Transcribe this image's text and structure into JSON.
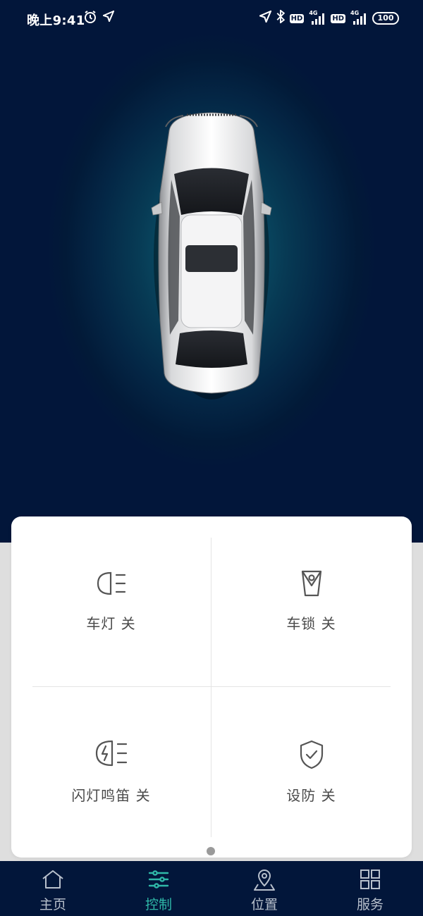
{
  "status_bar": {
    "time": "晚上9:41",
    "hd_label": "HD",
    "network_label": "4G",
    "battery": "100"
  },
  "controls": [
    {
      "label": "车灯 关",
      "icon": "headlight-icon"
    },
    {
      "label": "车锁 关",
      "icon": "lock-icon"
    },
    {
      "label": "闪灯鸣笛 关",
      "icon": "flash-horn-icon"
    },
    {
      "label": "设防 关",
      "icon": "shield-check-icon"
    }
  ],
  "tabs": [
    {
      "label": "主页",
      "icon": "home-icon",
      "active": false
    },
    {
      "label": "控制",
      "icon": "sliders-icon",
      "active": true
    },
    {
      "label": "位置",
      "icon": "location-pin-icon",
      "active": false
    },
    {
      "label": "服务",
      "icon": "grid-icon",
      "active": false
    }
  ],
  "colors": {
    "hero_bg": "#02163a",
    "hero_glow": "#0e6a82",
    "active_tab": "#2fb8a8",
    "inactive_tab": "#b8c0cc",
    "label_text": "#4a4a4a",
    "icon_stroke": "#555555"
  }
}
